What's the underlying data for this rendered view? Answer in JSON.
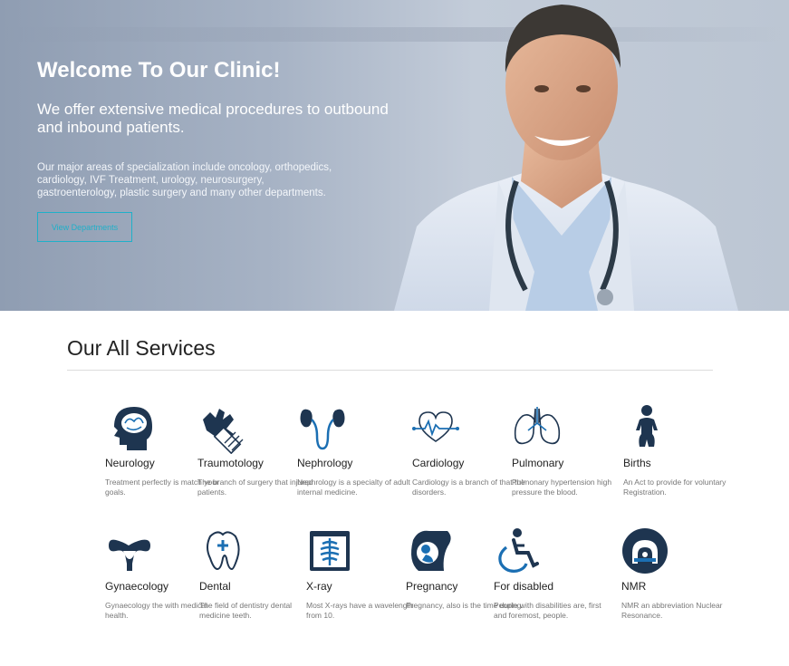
{
  "hero": {
    "title": "Welcome To Our Clinic!",
    "subtitle": "We offer extensive medical procedures to outbound and inbound patients.",
    "description": "Our major areas of specialization include oncology, orthopedics, cardiology, IVF Treatment, urology, neurosurgery, gastroenterology, plastic surgery and many other departments.",
    "button_label": "View Departments"
  },
  "services": {
    "title": "Our All Services",
    "items": [
      {
        "name": "Neurology",
        "desc": "Treatment perfectly is match your goals.",
        "icon": "brain-head-icon"
      },
      {
        "name": "Traumotology",
        "desc": "The branch of surgery that injured patients.",
        "icon": "bandaged-hand-icon"
      },
      {
        "name": "Nephrology",
        "desc": "Nephrology is a specialty of adult internal medicine.",
        "icon": "kidneys-icon"
      },
      {
        "name": "Cardiology",
        "desc": "Cardiology is a branch of that the disorders.",
        "icon": "heartbeat-icon"
      },
      {
        "name": "Pulmonary",
        "desc": "Pulmonary hypertension high pressure the blood.",
        "icon": "lungs-icon"
      },
      {
        "name": "Births",
        "desc": "An Act to provide for voluntary Registration.",
        "icon": "baby-icon"
      },
      {
        "name": "Gynaecology",
        "desc": "Gynaecology the with medical health.",
        "icon": "uterus-icon"
      },
      {
        "name": "Dental",
        "desc": "The field of dentistry dental medicine teeth.",
        "icon": "tooth-icon"
      },
      {
        "name": "X-ray",
        "desc": "Most X-rays have a wavelength from 10.",
        "icon": "xray-icon"
      },
      {
        "name": "Pregnancy",
        "desc": "Pregnancy, also is the time during.",
        "icon": "pregnancy-icon"
      },
      {
        "name": "For disabled",
        "desc": "People with disabilities are, first and foremost, people.",
        "icon": "wheelchair-icon"
      },
      {
        "name": "NMR",
        "desc": "NMR an abbreviation Nuclear Resonance.",
        "icon": "mri-scanner-icon"
      }
    ]
  },
  "colors": {
    "accent": "#1fb0c9",
    "icon_dark": "#1e3550",
    "icon_blue": "#1b6fb3"
  }
}
